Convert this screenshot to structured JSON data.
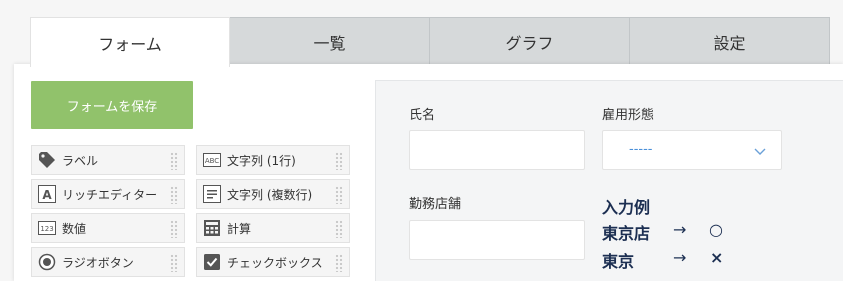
{
  "tabs": [
    {
      "label": "フォーム",
      "active": true
    },
    {
      "label": "一覧",
      "active": false
    },
    {
      "label": "グラフ",
      "active": false
    },
    {
      "label": "設定",
      "active": false
    }
  ],
  "toolbar": {
    "save_label": "フォームを保存",
    "save_color": "#91c26b"
  },
  "palette": {
    "items": [
      {
        "label": "ラベル",
        "icon": "tag-icon"
      },
      {
        "label": "文字列 (1行)",
        "icon": "abc-icon"
      },
      {
        "label": "リッチエディター",
        "icon": "rich-editor-icon"
      },
      {
        "label": "文字列 (複数行)",
        "icon": "multiline-icon"
      },
      {
        "label": "数値",
        "icon": "number-123-icon"
      },
      {
        "label": "計算",
        "icon": "calculator-icon"
      },
      {
        "label": "ラジオボタン",
        "icon": "radio-icon"
      },
      {
        "label": "チェックボックス",
        "icon": "checkbox-icon"
      }
    ]
  },
  "form": {
    "name_label": "氏名",
    "employment_label": "雇用形態",
    "employment_value": "-----",
    "store_label": "勤務店舗",
    "example_title": "入力例",
    "example_rows": [
      {
        "text": "東京店",
        "arrow": "→",
        "mark": "○"
      },
      {
        "text": "東京",
        "arrow": "→",
        "mark": "×"
      }
    ]
  }
}
